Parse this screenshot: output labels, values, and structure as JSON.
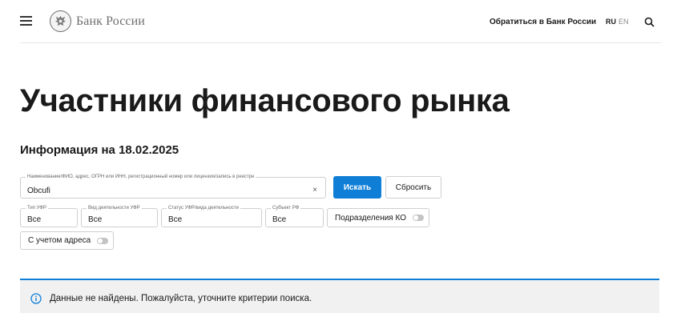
{
  "header": {
    "brand": "Банк России",
    "contact_link": "Обратиться в Банк России",
    "lang_ru": "RU",
    "lang_en": "EN",
    "icons": {
      "menu": "hamburger-menu-icon",
      "logo": "eagle-emblem-icon",
      "search": "search-icon"
    }
  },
  "page": {
    "title": "Участники финансового рынка",
    "info_label": "Информация на 18.02.2025"
  },
  "search": {
    "label": "Наименование/ФИО, адрес, ОГРН или ИНН, регистрационный номер или лицензия/запись в реестре",
    "value": "Obcufi",
    "clear": "×",
    "submit_label": "Искать",
    "reset_label": "Сбросить"
  },
  "filters": [
    {
      "label": "Тип УФР",
      "value": "Все"
    },
    {
      "label": "Вид деятельности УФР",
      "value": "Все"
    },
    {
      "label": "Статус УФР/вида деятельности",
      "value": "Все"
    },
    {
      "label": "Субъект РФ",
      "value": "Все"
    }
  ],
  "toggles": {
    "branches_label": "Подразделения КО",
    "branches_on": false,
    "address_label": "С учетом адреса",
    "address_on": false
  },
  "alert": {
    "message": "Данные не найдены. Пожалуйста, уточните критерии поиска.",
    "icon": "info-icon",
    "accent": "#0f7ed6"
  },
  "colors": {
    "primary": "#0f7ed6",
    "border": "#cfcfcf",
    "alert_bg": "#f1f1f1"
  }
}
